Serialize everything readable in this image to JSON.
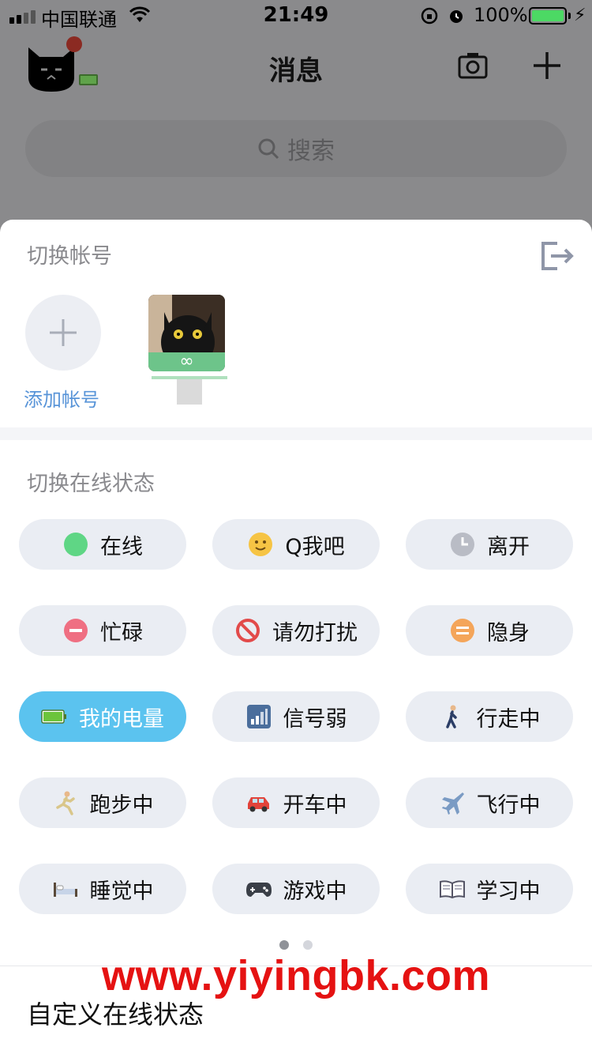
{
  "status_bar": {
    "carrier": "中国联通",
    "time": "21:49",
    "battery_percent": "100%",
    "battery_color": "#4cd964"
  },
  "header": {
    "title": "消息",
    "camera_icon": "camera-icon",
    "plus_icon": "plus-icon",
    "notification_dot_color": "#8b2a22"
  },
  "search": {
    "placeholder": "搜索"
  },
  "account_sheet": {
    "title": "切换帐号",
    "add_account_label": "添加帐号",
    "logout_icon": "logout-icon",
    "account_badge": "∞"
  },
  "online_status": {
    "title": "切换在线状态",
    "options": [
      {
        "label": "在线",
        "icon": "green-circle-icon"
      },
      {
        "label": "Q我吧",
        "icon": "smile-face-icon"
      },
      {
        "label": "离开",
        "icon": "clock-icon"
      },
      {
        "label": "忙碌",
        "icon": "minus-circle-icon"
      },
      {
        "label": "请勿打扰",
        "icon": "no-entry-icon"
      },
      {
        "label": "隐身",
        "icon": "equals-circle-icon"
      },
      {
        "label": "我的电量",
        "icon": "battery-icon",
        "selected": true
      },
      {
        "label": "信号弱",
        "icon": "signal-bars-icon"
      },
      {
        "label": "行走中",
        "icon": "walking-icon"
      },
      {
        "label": "跑步中",
        "icon": "running-icon"
      },
      {
        "label": "开车中",
        "icon": "car-icon"
      },
      {
        "label": "飞行中",
        "icon": "airplane-icon"
      },
      {
        "label": "睡觉中",
        "icon": "bed-icon"
      },
      {
        "label": "游戏中",
        "icon": "gamepad-icon"
      },
      {
        "label": "学习中",
        "icon": "book-icon"
      }
    ],
    "selected_color": "#5bc3ef",
    "page_count": 2,
    "current_page": 1
  },
  "custom_status": {
    "label": "自定义在线状态"
  },
  "watermark": {
    "text": "www.yiyingbk.com",
    "color": "#e51212"
  }
}
